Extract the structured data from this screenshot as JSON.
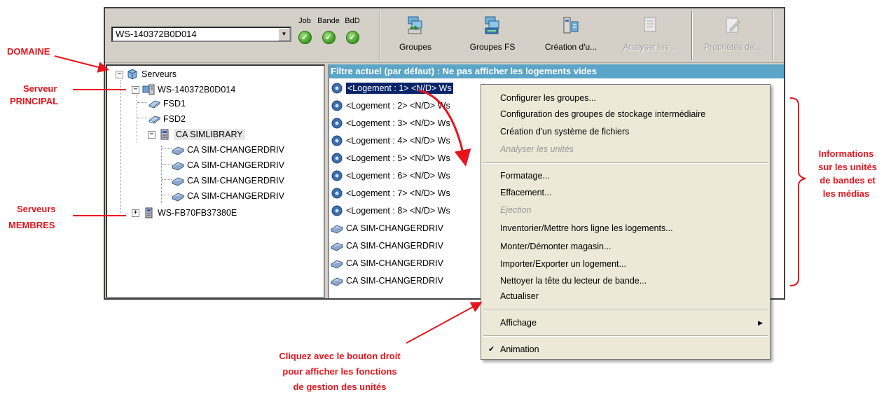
{
  "toolbar": {
    "server_value": "WS-140372B0D014",
    "status": [
      {
        "label": "Job"
      },
      {
        "label": "Bande"
      },
      {
        "label": "BdD"
      }
    ],
    "buttons": [
      {
        "label": "Groupes"
      },
      {
        "label": "Groupes FS"
      },
      {
        "label": "Création d'u..."
      },
      {
        "label": "Analyser les ..."
      },
      {
        "label": "Propriétés de..."
      }
    ]
  },
  "tree": {
    "root": "Serveurs",
    "primary": "WS-140372B0D014",
    "fsd1": "FSD1",
    "fsd2": "FSD2",
    "library": "CA SIMLIBRARY",
    "drives": [
      "CA SIM-CHANGERDRIV",
      "CA SIM-CHANGERDRIV",
      "CA SIM-CHANGERDRIV",
      "CA SIM-CHANGERDRIV"
    ],
    "member": "WS-FB70FB37380E"
  },
  "list": {
    "filter": "Filtre actuel (par défaut) :  Ne pas afficher les logements vides",
    "slots": [
      "<Logement :   1> <N/D> Wѕ",
      "<Logement :   2> <N/D> Wѕ",
      "<Logement :   3> <N/D> Wѕ",
      "<Logement :   4> <N/D> Wѕ",
      "<Logement :   5> <N/D> Wѕ",
      "<Logement :   6> <N/D> Wѕ",
      "<Logement :   7> <N/D> Wѕ",
      "<Logement :   8> <N/D> Wѕ"
    ],
    "drives": [
      "CA SIM-CHANGERDRIV",
      "CA SIM-CHANGERDRIV",
      "CA SIM-CHANGERDRIV",
      "CA SIM-CHANGERDRIV"
    ]
  },
  "context_menu": {
    "group1": [
      "Configurer les groupes...",
      "Configuration des groupes de stockage intermédiaire",
      "Création d'un système de fichiers"
    ],
    "analyse": "Analyser les unités",
    "group2a": [
      "Formatage...",
      "Effacement..."
    ],
    "ejection": "Ejection",
    "group2b": [
      "Inventorier/Mettre hors ligne les logements...",
      "Monter/Démonter magasin...",
      "Importer/Exporter un logement...",
      "Nettoyer la tête du lecteur de bande...",
      "Actualiser"
    ],
    "display": "Affichage",
    "animation": "Animation"
  },
  "annotations": {
    "domaine": "DOMAINE",
    "principal_1": "Serveur",
    "principal_2": "PRINCIPAL",
    "membres_1": "Serveurs",
    "membres_2": "MEMBRES",
    "info_1": "Informations",
    "info_2": "sur les unités",
    "info_3": "de bandes et",
    "info_4": "les médias",
    "click_1": "Cliquez avec le bouton droit",
    "click_2": "pour afficher les fonctions",
    "click_3": "de gestion des unités"
  },
  "colors": {
    "filter_bar": "#5aa5c8",
    "selection": "#0a246a",
    "annotation": "#e8141c",
    "status_ok": "#3a9a1c"
  }
}
